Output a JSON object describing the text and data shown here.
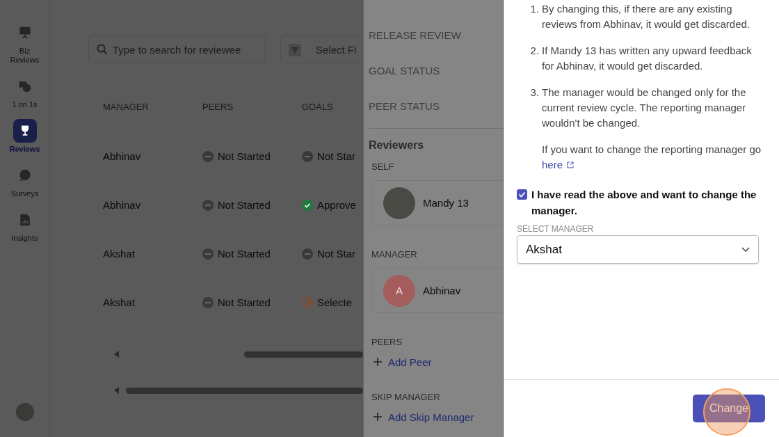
{
  "sidebar": {
    "items": [
      {
        "label": "Biz Reviews",
        "kind": "presentation",
        "selected": false
      },
      {
        "label": "1 on 1s",
        "kind": "chat",
        "selected": false
      },
      {
        "label": "Reviews",
        "kind": "trophy",
        "selected": true
      },
      {
        "label": "Surveys",
        "kind": "bubble",
        "selected": false
      },
      {
        "label": "Insights",
        "kind": "report",
        "selected": false
      }
    ]
  },
  "search": {
    "placeholder": "Type to search for reviewee"
  },
  "filter": {
    "placeholder": "Select Fi"
  },
  "table": {
    "columns": [
      "MANAGER",
      "PEERS",
      "GOALS"
    ],
    "rows": [
      {
        "manager": "Abhinav",
        "peers": {
          "kind": "not_started",
          "text": "Not Started"
        },
        "goals": {
          "kind": "not_started",
          "text": "Not Star"
        }
      },
      {
        "manager": "Abhinav",
        "peers": {
          "kind": "not_started",
          "text": "Not Started"
        },
        "goals": {
          "kind": "approved",
          "text": "Approve"
        }
      },
      {
        "manager": "Akshat",
        "peers": {
          "kind": "not_started",
          "text": "Not Started"
        },
        "goals": {
          "kind": "not_started",
          "text": "Not Star"
        }
      },
      {
        "manager": "Akshat",
        "peers": {
          "kind": "not_started",
          "text": "Not Started"
        },
        "goals": {
          "kind": "partial",
          "text": "Selecte"
        }
      }
    ]
  },
  "details": {
    "nav_items": [
      "RELEASE REVIEW",
      "GOAL STATUS",
      "PEER STATUS"
    ],
    "reviewers_title": "Reviewers",
    "groups": [
      {
        "label": "SELF",
        "kind": "photo_person",
        "name": "Mandy 13"
      },
      {
        "label": "MANAGER",
        "kind": "initial_person",
        "name": "Abhinav",
        "initial": "A"
      },
      {
        "label": "PEERS",
        "kind": "add",
        "action": "Add Peer"
      },
      {
        "label": "SKIP MANAGER",
        "kind": "add",
        "action": "Add Skip Manager"
      }
    ]
  },
  "dialog": {
    "notes": [
      {
        "number": "1.",
        "text": "By changing this, if there are any existing reviews from Abhinav, it would get discarded."
      },
      {
        "number": "2.",
        "text": "If Mandy 13 has written any upward feedback for Abhinav, it would get discarded."
      },
      {
        "number": "3.",
        "text": "The manager would be changed only for the current review cycle. The reporting manager wouldn't be changed."
      }
    ],
    "extra_note": "If you want to change the reporting manager go",
    "link": "here",
    "confirm": {
      "label": "I have read the above and want to change the manager.",
      "checked": true
    },
    "select": {
      "label": "SELECT MANAGER",
      "value": "Akshat"
    },
    "button": "Change"
  }
}
